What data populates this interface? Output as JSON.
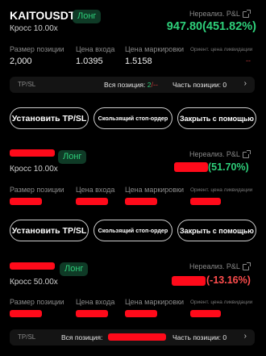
{
  "labels": {
    "position_size": "Размер позиции",
    "entry_price": "Цена входа",
    "mark_price": "Цена маркировки",
    "liq_price": "Ориент. цена ликвидации",
    "unrealized_pnl": "Нереализ. P&L",
    "tpsl": "TP/SL",
    "all_position": "Вся позиция:",
    "part_position": "Часть позиции:",
    "set_tpsl": "Установить TP/SL",
    "trailing_stop": "Скользящий стоп-ордер",
    "close_with_help": "Закрыть с помощью"
  },
  "positions": [
    {
      "symbol": "KAITOUSDT",
      "side": "Лонг",
      "leverage": "Кросс 10.00x",
      "pnl": "947.80(451.82%)",
      "size": "2,000",
      "entry": "1.0395",
      "mark": "1.5158",
      "liq": "--",
      "all_count": "2",
      "all_rest": "/--",
      "part_count": "0",
      "chevron": "›"
    },
    {
      "side": "Лонг",
      "leverage": "Кросс 10.00x",
      "pnl": "(51.70%)"
    },
    {
      "side": "Лонг",
      "leverage": "Кросс 50.00x",
      "pnl": "(-13.16%)",
      "part_count": "0",
      "chevron": "›"
    }
  ],
  "colors": {
    "profit": "#2ecf7a",
    "loss": "#ff4d4d",
    "redaction": "#ff0a1a"
  }
}
